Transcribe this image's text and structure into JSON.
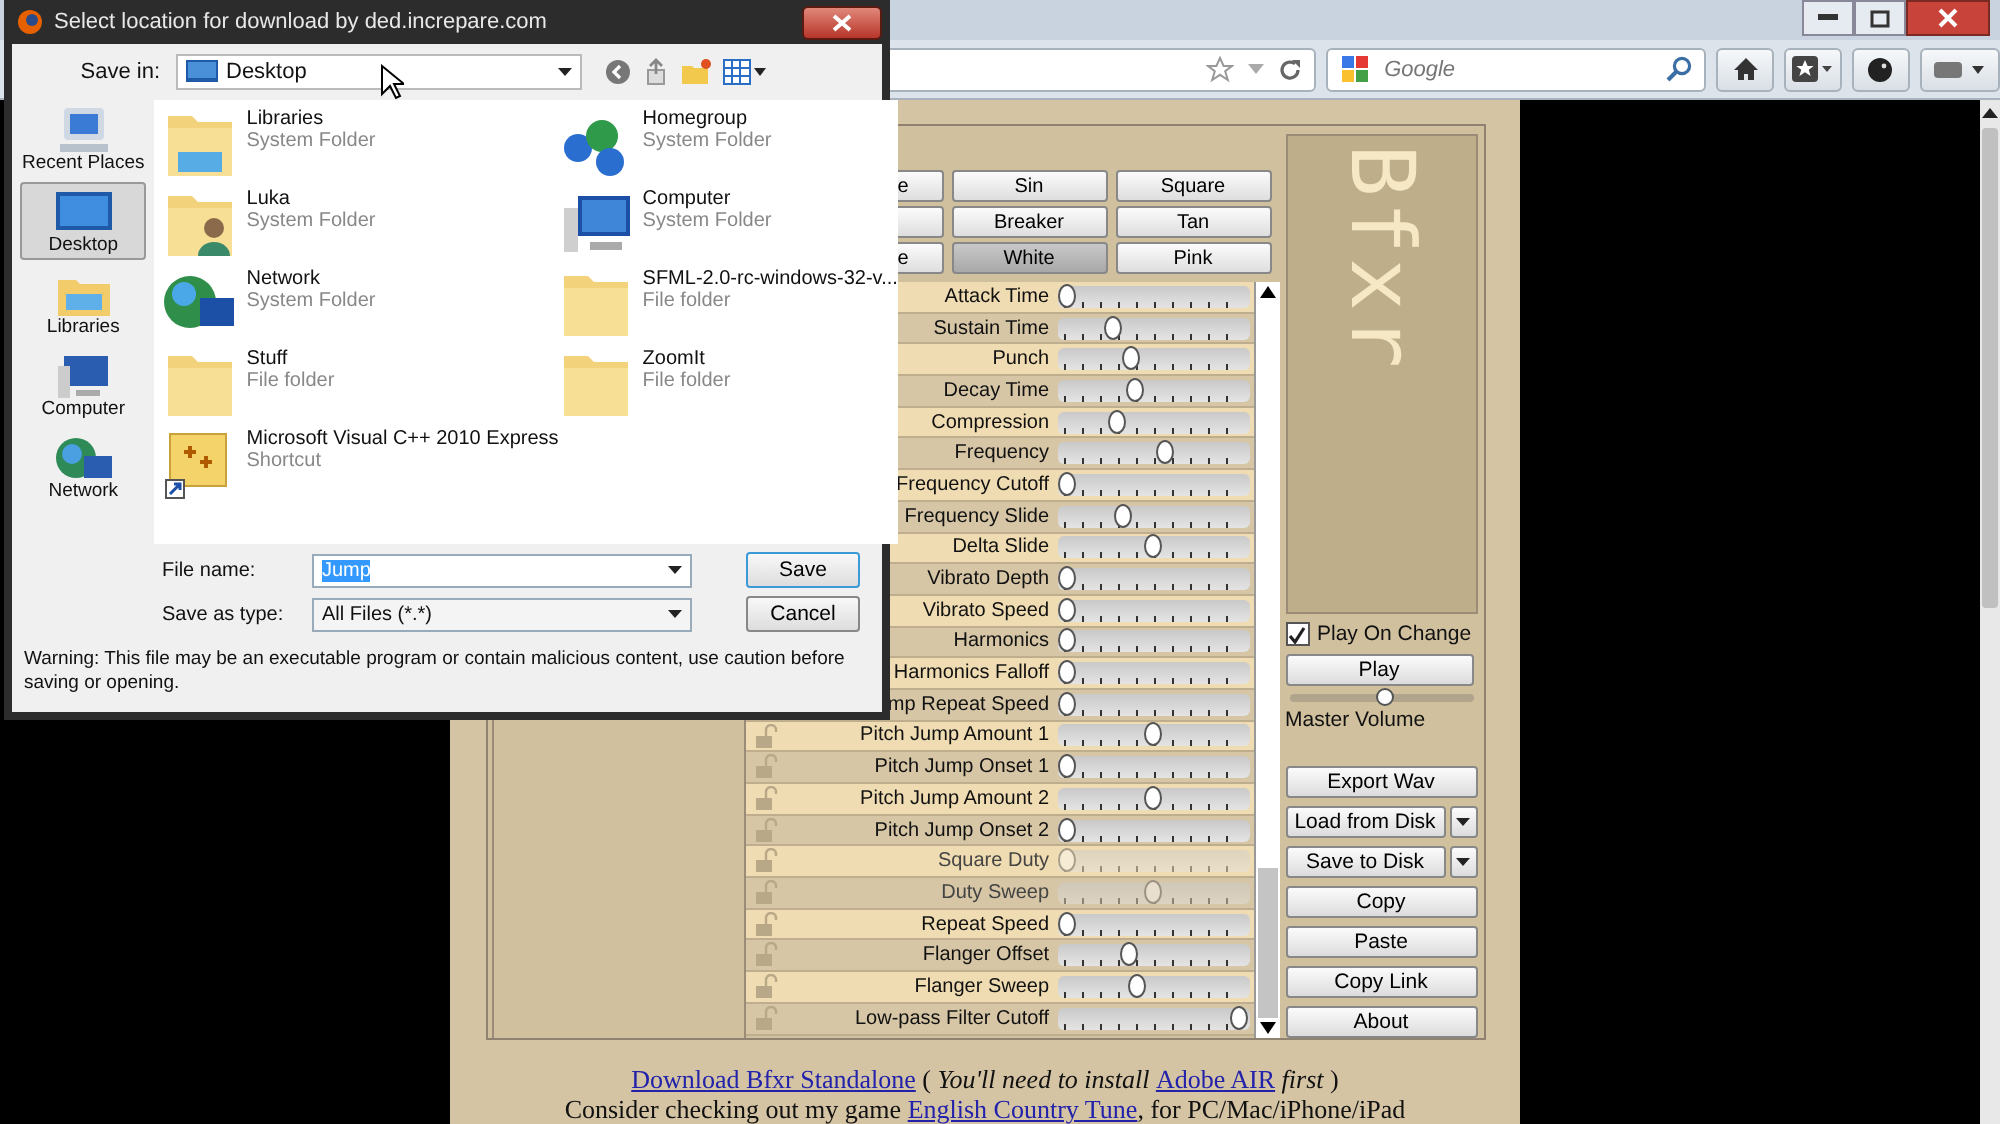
{
  "browser": {
    "search_placeholder": "Google"
  },
  "dialog": {
    "title": "Select location for download by ded.increpare.com",
    "save_in_label": "Save in:",
    "save_in_value": "Desktop",
    "places": [
      {
        "label": "Recent Places",
        "kind": "recent",
        "selected": false
      },
      {
        "label": "Desktop",
        "kind": "desktop",
        "selected": true
      },
      {
        "label": "Libraries",
        "kind": "libraries",
        "selected": false
      },
      {
        "label": "Computer",
        "kind": "computer",
        "selected": false
      },
      {
        "label": "Network",
        "kind": "network",
        "selected": false
      }
    ],
    "files": [
      {
        "name": "Libraries",
        "type": "System Folder",
        "kind": "libraries"
      },
      {
        "name": "Homegroup",
        "type": "System Folder",
        "kind": "homegroup"
      },
      {
        "name": "Luka",
        "type": "System Folder",
        "kind": "user"
      },
      {
        "name": "Computer",
        "type": "System Folder",
        "kind": "computer"
      },
      {
        "name": "Network",
        "type": "System Folder",
        "kind": "network"
      },
      {
        "name": "SFML-2.0-rc-windows-32-v...",
        "type": "File folder",
        "kind": "folder"
      },
      {
        "name": "Stuff",
        "type": "File folder",
        "kind": "folder"
      },
      {
        "name": "ZoomIt",
        "type": "File folder",
        "kind": "folder"
      },
      {
        "name": "Microsoft Visual C++ 2010 Express",
        "type": "Shortcut",
        "kind": "shortcut"
      }
    ],
    "file_name_label": "File name:",
    "file_name": "Jump",
    "save_as_type_label": "Save as type:",
    "save_as_type": "All Files (*.*)",
    "save_button": "Save",
    "cancel_button": "Cancel",
    "warning": "Warning: This file may be an executable program or contain malicious content, use caution before saving or opening."
  },
  "bfxr": {
    "wave_buttons": [
      {
        "label": "e",
        "selected": false
      },
      {
        "label": "Sin",
        "selected": false
      },
      {
        "label": "Square",
        "selected": false
      },
      {
        "selected": false
      },
      {
        "label": "Breaker",
        "selected": false
      },
      {
        "label": "Tan",
        "selected": false
      },
      {
        "label": "e",
        "selected": false
      },
      {
        "label": "White",
        "selected": true
      },
      {
        "label": "Pink",
        "selected": false
      }
    ],
    "sliders": [
      {
        "label": "Attack Time",
        "level": 0,
        "disabled": false
      },
      {
        "label": "Sustain Time",
        "level": 0.27,
        "disabled": false
      },
      {
        "label": "Punch",
        "level": 0.38,
        "disabled": false
      },
      {
        "label": "Decay Time",
        "level": 0.4,
        "disabled": false
      },
      {
        "label": "Compression",
        "level": 0.3,
        "disabled": false
      },
      {
        "label": "Frequency",
        "level": 0.57,
        "disabled": false
      },
      {
        "label": "Frequency Cutoff",
        "level": 0,
        "disabled": false
      },
      {
        "label": "Frequency Slide",
        "level": 0.33,
        "disabled": false
      },
      {
        "label": "Delta Slide",
        "level": 0.5,
        "disabled": false
      },
      {
        "label": "Vibrato Depth",
        "level": 0,
        "disabled": false
      },
      {
        "label": "Vibrato Speed",
        "level": 0,
        "disabled": false
      },
      {
        "label": "Harmonics",
        "level": 0,
        "disabled": false
      },
      {
        "label": "Harmonics Falloff",
        "level": 0,
        "disabled": false
      },
      {
        "label": "mp Repeat Speed",
        "level": 0,
        "disabled": false
      },
      {
        "label": "Pitch Jump Amount 1",
        "level": 0.5,
        "disabled": false,
        "locked": false
      },
      {
        "label": "Pitch Jump Onset 1",
        "level": 0,
        "disabled": false,
        "locked": false
      },
      {
        "label": "Pitch Jump Amount 2",
        "level": 0.5,
        "disabled": false,
        "locked": false
      },
      {
        "label": "Pitch Jump Onset 2",
        "level": 0,
        "disabled": false,
        "locked": false
      },
      {
        "label": "Square Duty",
        "level": 0,
        "disabled": true,
        "locked": false
      },
      {
        "label": "Duty Sweep",
        "level": 0.5,
        "disabled": true,
        "locked": false
      },
      {
        "label": "Repeat Speed",
        "level": 0,
        "disabled": false,
        "locked": false
      },
      {
        "label": "Flanger Offset",
        "level": 0.37,
        "disabled": false,
        "locked": false
      },
      {
        "label": "Flanger Sweep",
        "level": 0.41,
        "disabled": false,
        "locked": false
      },
      {
        "label": "Low-pass Filter Cutoff",
        "level": 1,
        "disabled": false,
        "locked": false
      }
    ],
    "logo": "Bfxr",
    "play_on_change": {
      "label": "Play On Change",
      "checked": true
    },
    "play_button": "Play",
    "master_volume": {
      "label": "Master Volume",
      "level": 0.5
    },
    "actions": [
      {
        "label": "Export Wav",
        "kind": "plain"
      },
      {
        "label": "Load from Disk",
        "kind": "dropdown"
      },
      {
        "label": "Save to Disk",
        "kind": "dropdown"
      },
      {
        "label": "Copy",
        "kind": "plain"
      },
      {
        "label": "Paste",
        "kind": "plain"
      },
      {
        "label": "Copy Link",
        "kind": "plain"
      },
      {
        "label": "About",
        "kind": "plain"
      }
    ]
  },
  "footer": [
    [
      {
        "text": "Download Bfxr Standalone",
        "kind": "link"
      },
      {
        "text": " ( ",
        "kind": "plain"
      },
      {
        "text": "You'll need to install ",
        "kind": "italic"
      },
      {
        "text": "Adobe AIR",
        "kind": "link"
      },
      {
        "text": " first",
        "kind": "italic"
      },
      {
        "text": " )",
        "kind": "plain"
      }
    ],
    [
      {
        "text": "Consider checking out my game ",
        "kind": "plain"
      },
      {
        "text": "English Country Tune",
        "kind": "link"
      },
      {
        "text": ", for PC/Mac/iPhone/iPad",
        "kind": "plain"
      }
    ]
  ]
}
